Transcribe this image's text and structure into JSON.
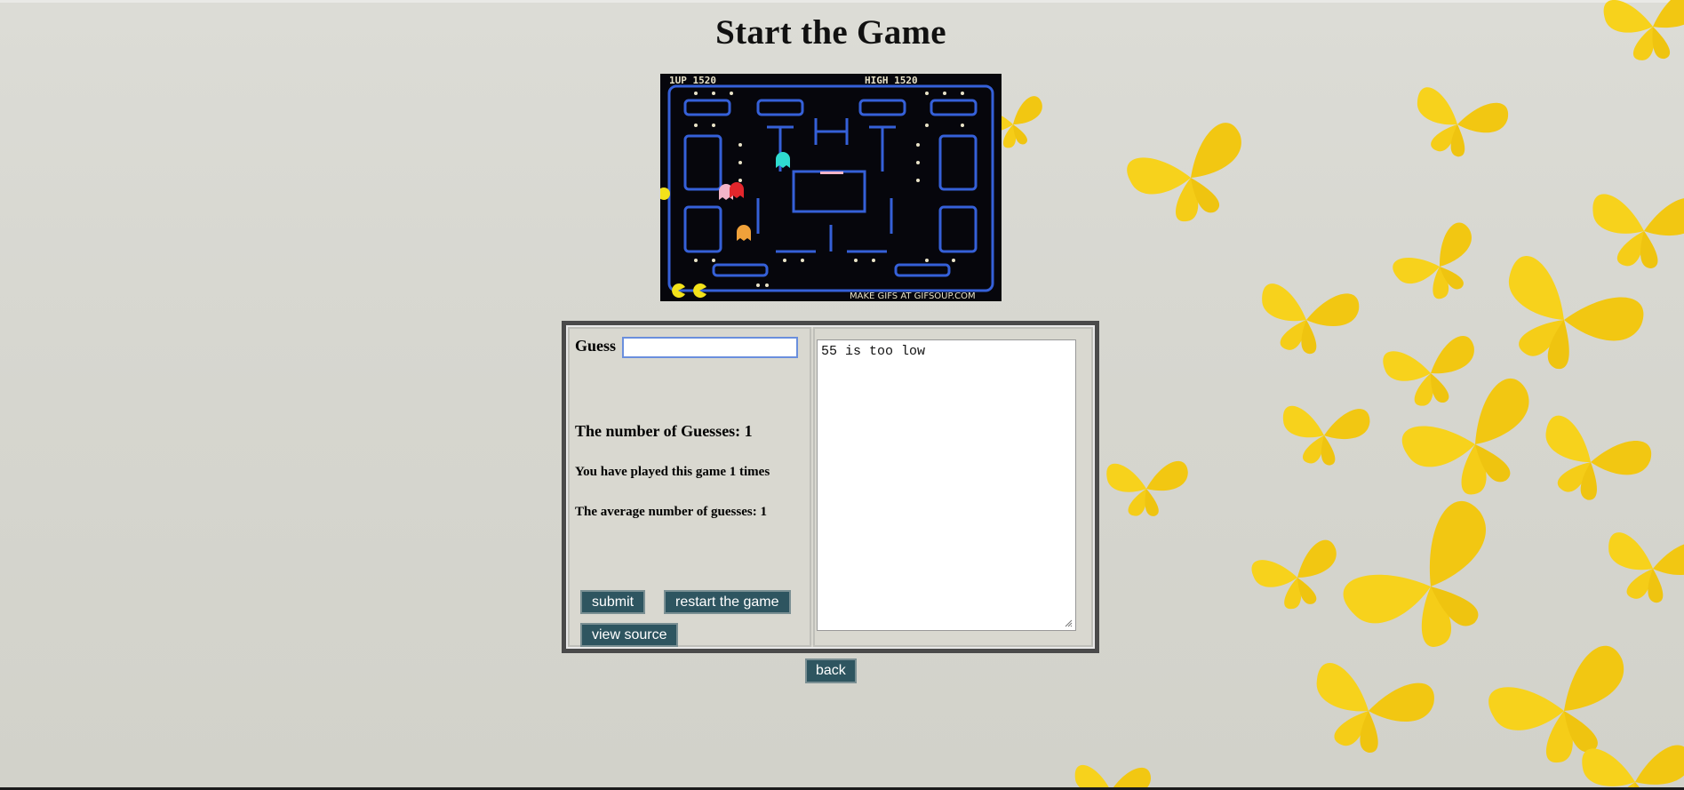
{
  "page": {
    "title": "Start the Game"
  },
  "game_image": {
    "hud_left": "1UP   1520",
    "hud_high": "HIGH   1520",
    "watermark": "MAKE GIFS AT GIFSOUP.COM"
  },
  "form": {
    "guess_label": "Guess",
    "guess_value": "",
    "guess_count_text": "The number of Guesses: 1",
    "played_text": "You have played this game 1 times",
    "average_text": "The average number of guesses: 1",
    "submit_label": "submit",
    "restart_label": "restart the game",
    "view_source_label": "view source"
  },
  "output": {
    "text": "55 is too low"
  },
  "nav": {
    "back_label": "back"
  },
  "colors": {
    "button_bg": "#2e5560",
    "butterfly": "#f5cf1a",
    "background": "#d8d8d1"
  }
}
